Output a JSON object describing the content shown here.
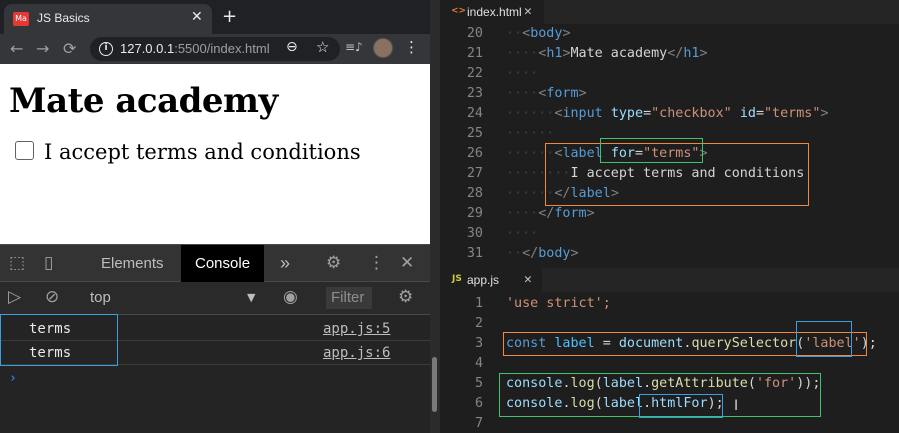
{
  "browser": {
    "tab": {
      "favicon": "Ma",
      "title": "JS Basics",
      "close": "✕",
      "new_tab": "+"
    },
    "nav": {
      "back": "←",
      "forward": "→",
      "reload": "⟳"
    },
    "address": {
      "host": "127.0.0.1",
      "rest": ":5500/index.html",
      "info_icon": "i"
    },
    "icons": {
      "zoom": "⊖",
      "star": "☆",
      "media": "≡♪",
      "menu": "⋮"
    },
    "page": {
      "heading": "Mate academy",
      "checkbox_label": "I accept terms and conditions"
    }
  },
  "devtools": {
    "tabs": {
      "elements": "Elements",
      "console": "Console",
      "more": "»"
    },
    "icons": {
      "inspect": "⬚",
      "device": "▯",
      "settings": "⚙",
      "kebab": "⋮",
      "close": "✕",
      "sidebar": "▷",
      "clear": "⊘",
      "eye": "◉",
      "gear": "⚙"
    },
    "context": "top",
    "context_arrow": "▼",
    "filter_placeholder": "Filter",
    "logs": [
      {
        "message": "terms",
        "source": "app.js:5"
      },
      {
        "message": "terms",
        "source": "app.js:6"
      }
    ],
    "prompt": "›"
  },
  "editor": {
    "html_tab": {
      "icon": "<>",
      "name": "index.html",
      "close": "✕"
    },
    "js_tab": {
      "icon": "JS",
      "name": "app.js",
      "close": "✕"
    },
    "html_lines": {
      "n20": "20",
      "n21": "21",
      "n22": "22",
      "n23": "23",
      "n24": "24",
      "n25": "25",
      "n26": "26",
      "n27": "27",
      "n28": "28",
      "n29": "29",
      "n30": "30",
      "n31": "31",
      "l27_text": "I accept terms and conditions",
      "h1_text": "Mate academy"
    },
    "js_lines": {
      "n1": "1",
      "n2": "2",
      "n3": "3",
      "n4": "4",
      "n5": "5",
      "n6": "6",
      "n7": "7",
      "l1": "'use strict';"
    },
    "accent_colors": {
      "orange": "#f0883e",
      "blue": "#3a9ee0",
      "green": "#3cc46a"
    }
  }
}
